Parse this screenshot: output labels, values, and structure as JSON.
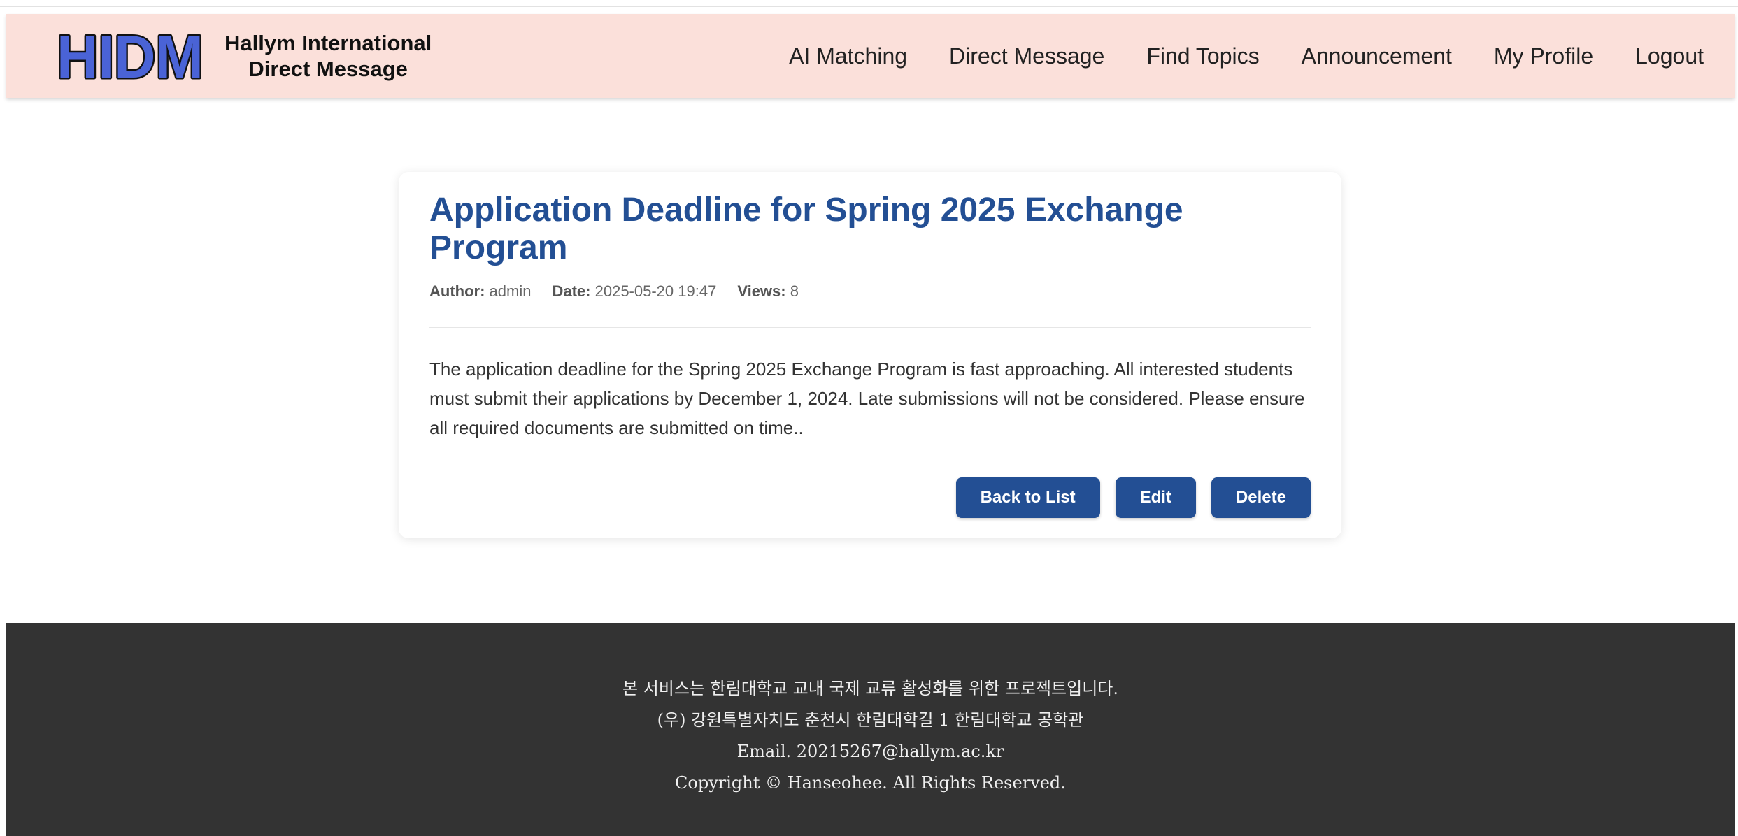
{
  "header": {
    "logo_text": "HIDM",
    "brand_line1": "Hallym International",
    "brand_line2": "Direct Message",
    "nav": [
      "AI Matching",
      "Direct Message",
      "Find Topics",
      "Announcement",
      "My Profile",
      "Logout"
    ]
  },
  "post": {
    "title": "Application Deadline for Spring 2025 Exchange Program",
    "author_label": "Author:",
    "author": "admin",
    "date_label": "Date:",
    "date": "2025-05-20 19:47",
    "views_label": "Views:",
    "views": "8",
    "content": "The application deadline for the Spring 2025 Exchange Program is fast approaching. All interested students must submit their applications by December 1, 2024. Late submissions will not be considered. Please ensure all required documents are submitted on time.."
  },
  "actions": {
    "back_label": "Back to List",
    "edit_label": "Edit",
    "delete_label": "Delete"
  },
  "footer": {
    "line1": "본 서비스는 한림대학교 교내 국제 교류 활성화를 위한 프로젝트입니다.",
    "line2": "(우) 강원특별자치도 춘천시 한림대학길 1 한림대학교 공학관",
    "line3": "Email. 20215267@hallym.ac.kr",
    "line4": "Copyright © Hanseohee. All Rights Reserved."
  },
  "colors": {
    "header_bg": "#fbe0da",
    "logo_fill": "#4a63d6",
    "title": "#234f94",
    "button": "#234f94",
    "footer_bg": "#333333"
  }
}
